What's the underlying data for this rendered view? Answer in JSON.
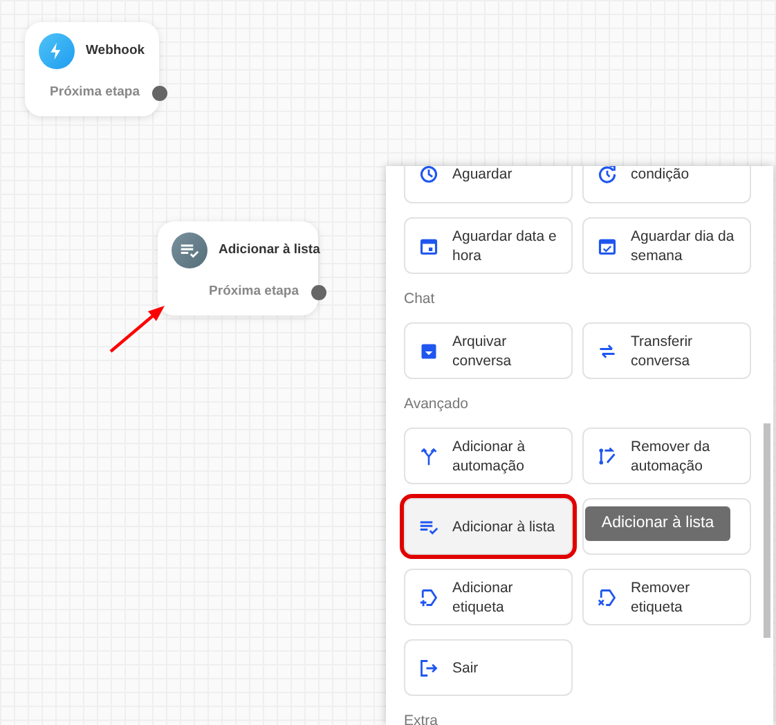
{
  "canvas": {
    "nodes": [
      {
        "title": "Webhook",
        "kind": "trigger",
        "output_label": "Próxima etapa"
      },
      {
        "title": "Adicionar à lista",
        "kind": "list-add",
        "output_label": "Próxima etapa"
      }
    ],
    "annotation": {
      "kind": "arrow"
    }
  },
  "panel": {
    "sections": [
      {
        "items": [
          {
            "label": "Aguardar",
            "kind": "wait",
            "selected": false
          },
          {
            "label": "condição",
            "kind": "wait-condition",
            "selected": false
          }
        ]
      },
      {
        "items": [
          {
            "label": "Aguardar data e hora",
            "kind": "wait-date",
            "selected": false
          },
          {
            "label": "Aguardar dia da semana",
            "kind": "wait-weekday",
            "selected": false
          }
        ]
      },
      {
        "title": "Chat",
        "items": [
          {
            "label": "Arquivar conversa",
            "kind": "archive",
            "selected": false
          },
          {
            "label": "Transferir conversa",
            "kind": "transfer",
            "selected": false
          }
        ]
      },
      {
        "title": "Avançado",
        "items": [
          {
            "label": "Adicionar à automação",
            "kind": "automation-add",
            "selected": false
          },
          {
            "label": "Remover da automação",
            "kind": "automation-remove",
            "selected": false
          },
          {
            "label": "Adicionar à lista",
            "kind": "list-add",
            "selected": true
          },
          {
            "kind": "covered",
            "selected": false
          },
          {
            "label": "Adicionar etiqueta",
            "kind": "tag-add",
            "selected": false
          },
          {
            "label": "Remover etiqueta",
            "kind": "tag-remove",
            "selected": false
          },
          {
            "label": "Sair",
            "kind": "exit",
            "selected": false
          }
        ]
      },
      {
        "title": "Extra"
      }
    ],
    "tooltip": "Adicionar à lista"
  }
}
